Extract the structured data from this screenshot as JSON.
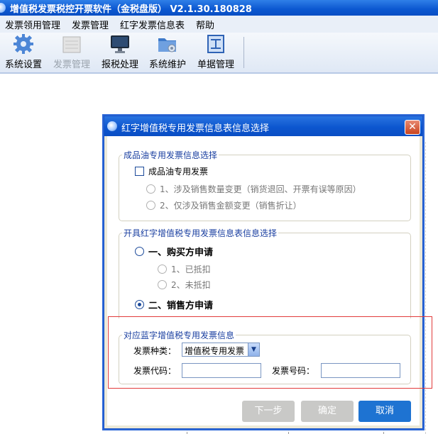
{
  "app": {
    "title": "增值税发票税控开票软件（金税盘版） V2.1.30.180828"
  },
  "menu": [
    "发票领用管理",
    "发票管理",
    "红字发票信息表",
    "帮助"
  ],
  "toolbar": {
    "items": [
      {
        "label": "系统设置",
        "icon": "gear-icon",
        "enabled": true
      },
      {
        "label": "发票管理",
        "icon": "invoice-icon",
        "enabled": false
      },
      {
        "label": "报税处理",
        "icon": "monitor-icon",
        "enabled": true
      },
      {
        "label": "系统维护",
        "icon": "folder-gear-icon",
        "enabled": true
      },
      {
        "label": "单据管理",
        "icon": "document-icon",
        "enabled": true
      }
    ]
  },
  "dialog": {
    "title": "红字增值税专用发票信息表信息选择",
    "close_glyph": "✕",
    "group_oil": {
      "legend": "成品油专用发票信息选择",
      "checkbox_label": "成品油专用发票",
      "option1": "1、涉及销售数量变更（销货退回、开票有误等原因）",
      "option2": "2、仅涉及销售金额变更（销售折让）"
    },
    "group_apply": {
      "legend": "开具红字增值税专用发票信息表信息选择",
      "buyer": "一、购买方申请",
      "buyer_sub1": "1、已抵扣",
      "buyer_sub2": "2、未抵扣",
      "seller": "二、销售方申请"
    },
    "group_blue": {
      "legend": "对应蓝字增值税专用发票信息",
      "type_label": "发票种类：",
      "type_value": "增值税专用发票",
      "code_label": "发票代码：",
      "code_value": "",
      "number_label": "发票号码：",
      "number_value": ""
    },
    "buttons": {
      "next": "下一步",
      "ok": "确定",
      "cancel": "取消"
    }
  },
  "colors": {
    "titlebar": "#0b57d0",
    "highlight_box": "#e23b3b",
    "primary_button": "#1e73d2",
    "legend_text": "#1a3fa0"
  }
}
